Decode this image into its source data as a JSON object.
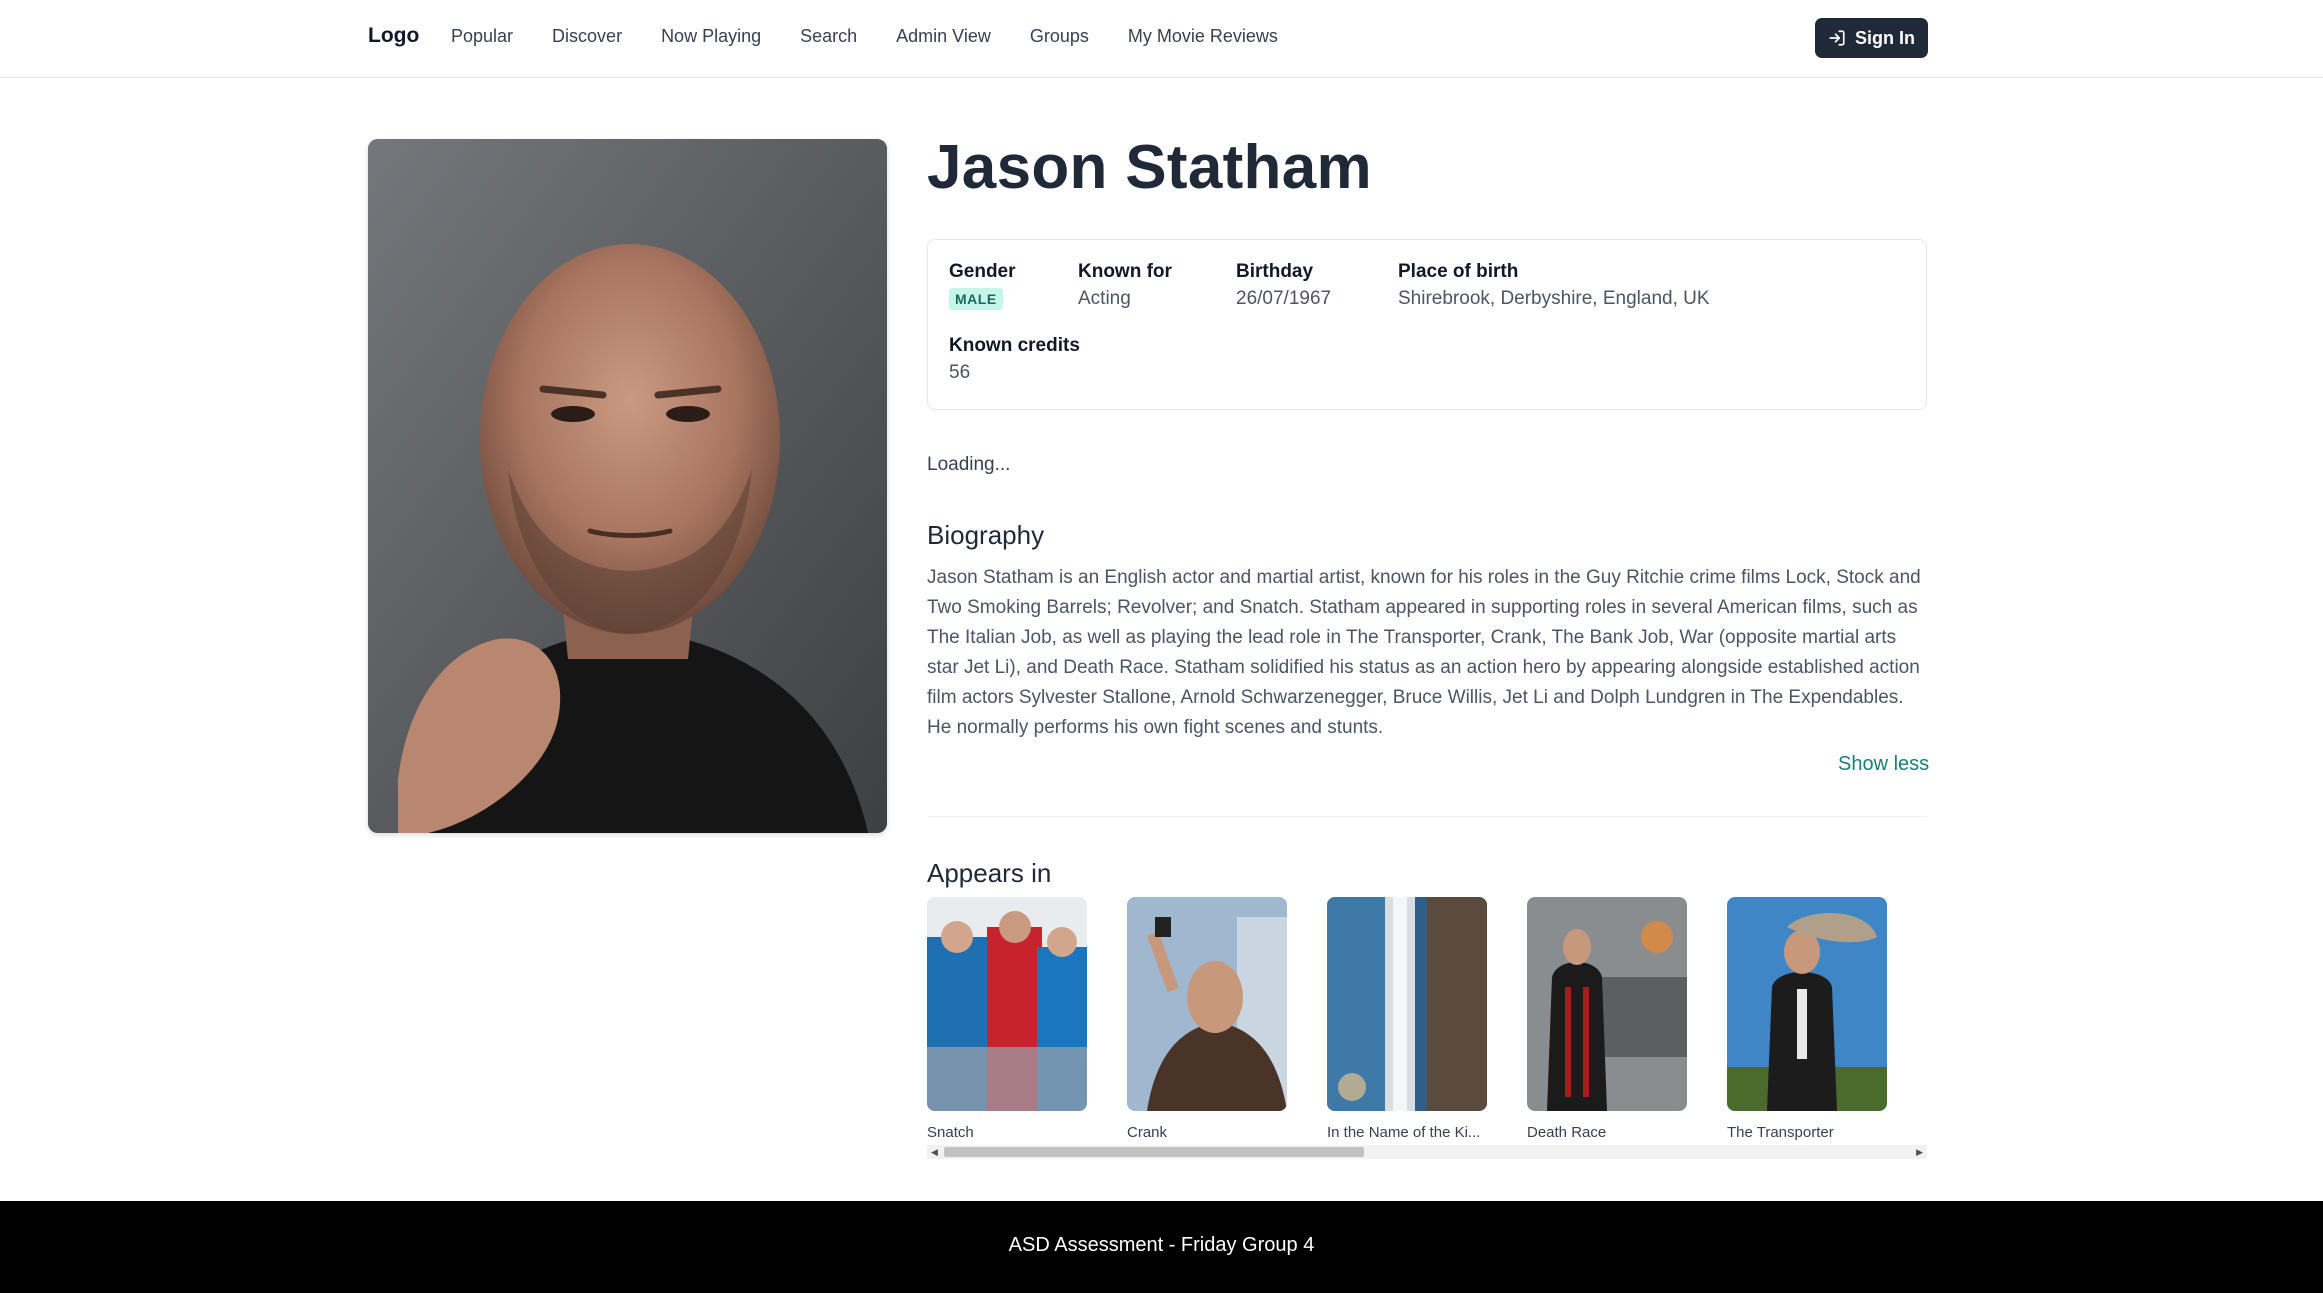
{
  "nav": {
    "logo": "Logo",
    "links": [
      "Popular",
      "Discover",
      "Now Playing",
      "Search",
      "Admin View",
      "Groups",
      "My Movie Reviews"
    ],
    "signin_label": "Sign In"
  },
  "person": {
    "name": "Jason Statham",
    "gender_label": "Gender",
    "gender_value": "MALE",
    "known_for_label": "Known for",
    "known_for_value": "Acting",
    "birthday_label": "Birthday",
    "birthday_value": "26/07/1967",
    "place_label": "Place of birth",
    "place_value": "Shirebrook, Derbyshire, England, UK",
    "credits_label": "Known credits",
    "credits_value": "56"
  },
  "loading_text": "Loading...",
  "biography": {
    "title": "Biography",
    "text": "Jason Statham is an English actor and martial artist, known for his roles in the Guy Ritchie crime films Lock, Stock and Two Smoking Barrels; Revolver; and Snatch. Statham appeared in supporting roles in several American films, such as The Italian Job, as well as playing the lead role in The Transporter, Crank, The Bank Job, War (opposite martial arts star Jet Li), and Death Race. Statham solidified his status as an action hero by appearing alongside established action film actors Sylvester Stallone, Arnold Schwarzenegger, Bruce Willis, Jet Li and Dolph Lundgren in The Expendables. He normally performs his own fight scenes and stunts.",
    "toggle_label": "Show less"
  },
  "appears_in": {
    "title": "Appears in",
    "movies": [
      {
        "title": "Snatch"
      },
      {
        "title": "Crank"
      },
      {
        "title": "In the Name of the Ki..."
      },
      {
        "title": "Death Race"
      },
      {
        "title": "The Transporter"
      }
    ]
  },
  "footer": {
    "text": "ASD Assessment - Friday Group 4"
  },
  "colors": {
    "badge_bg": "#c6f6ea",
    "link_accent": "#1a7f76",
    "signin_bg": "#1f2937",
    "footer_bg": "#000000"
  }
}
